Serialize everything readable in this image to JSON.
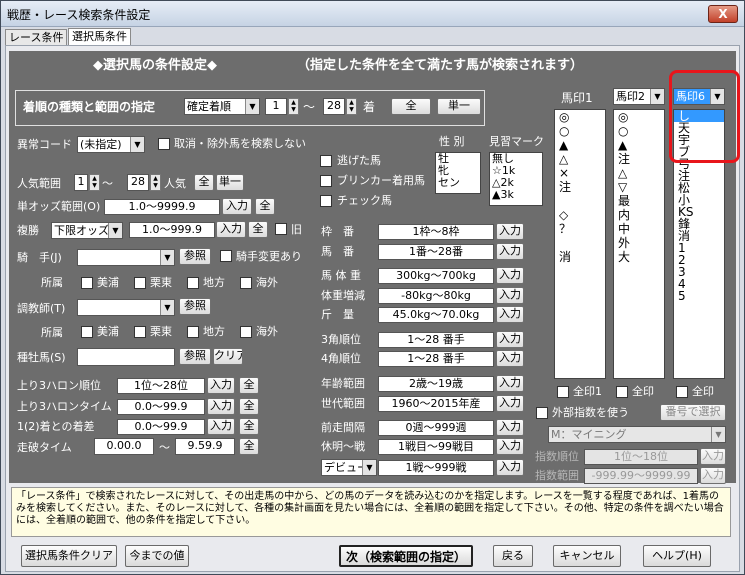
{
  "window": {
    "title": "戦歴・レース検索条件設定",
    "close": "X"
  },
  "tabs": [
    "レース条件",
    "選択馬条件"
  ],
  "header": {
    "title": "◆選択馬の条件設定◆",
    "subtitle": "（指定した条件を全て満たす馬が検索されます）"
  },
  "rank": {
    "label": "着順の種類と範囲の指定",
    "type": "確定着順",
    "from": "1",
    "sep": "～",
    "to": "28",
    "unit": "着",
    "all": "全",
    "single": "単一"
  },
  "ijo": {
    "label": "異常コード",
    "value": "(未指定)",
    "exclude": "取消・除外馬を検索しない"
  },
  "sex": {
    "label": "性 別",
    "items": [
      "牡",
      "牝",
      "セン"
    ]
  },
  "minarai": {
    "label": "見習マーク",
    "items": [
      "無し",
      "☆1k",
      "△2k",
      "▲3k"
    ]
  },
  "flags": [
    "逃げた馬",
    "ブリンカー着用馬",
    "チェック馬"
  ],
  "ninki": {
    "label": "人気範囲",
    "from": "1",
    "sep": "～",
    "to": "28",
    "unit": "人気",
    "all": "全",
    "single": "単一"
  },
  "tanodds": {
    "label": "単オッズ範囲(O)",
    "value": "1.0～9999.9",
    "input": "入力",
    "all": "全"
  },
  "fukusho": {
    "label": "複勝",
    "type": "下限オッズ",
    "value": "1.0～999.9",
    "input": "入力",
    "all": "全",
    "old": "旧"
  },
  "jockey": {
    "label": "騎　手(J)",
    "ref": "参照",
    "change": "騎手変更あり"
  },
  "shozoku": {
    "label": "所属",
    "items": [
      "美浦",
      "栗東",
      "地方",
      "海外"
    ]
  },
  "trainer": {
    "label": "調教師(T)",
    "ref": "参照"
  },
  "sire": {
    "label": "種牡馬(S)",
    "ref": "参照",
    "clear": "クリア"
  },
  "left_rows": [
    {
      "label": "上り3ハロン順位",
      "value": "1位～28位",
      "input": "入力",
      "all": "全"
    },
    {
      "label": "上り3ハロンタイム",
      "value": "0.0～99.9",
      "input": "入力",
      "all": "全"
    },
    {
      "label": "1(2)着との着差",
      "value": "0.0～99.9",
      "input": "入力",
      "all": "全"
    },
    {
      "label": "走破タイム",
      "from": "0.00.0",
      "sep": "～",
      "to": "9.59.9",
      "all": "全"
    }
  ],
  "mid_rows": [
    {
      "label": "枠　番",
      "value": "1枠～8枠",
      "input": "入力"
    },
    {
      "label": "馬　番",
      "value": "1番～28番",
      "input": "入力"
    },
    {
      "label": "馬 体 重",
      "value": "300kg～700kg",
      "input": "入力"
    },
    {
      "label": "体重増減",
      "value": "-80kg～80kg",
      "input": "入力"
    },
    {
      "label": "斤　量",
      "value": "45.0kg～70.0kg",
      "input": "入力"
    },
    {
      "label": "3角順位",
      "value": "1～28 番手",
      "input": "入力"
    },
    {
      "label": "4角順位",
      "value": "1～28 番手",
      "input": "入力"
    },
    {
      "label": "年齢範囲",
      "value": "2歳～19歳",
      "input": "入力"
    },
    {
      "label": "世代範囲",
      "value": "1960～2015年産",
      "input": "入力"
    },
    {
      "label": "前走間隔",
      "value": "0週～999週",
      "input": "入力"
    },
    {
      "label": "休明～戦",
      "value": "1戦目～99戦目",
      "input": "入力"
    },
    {
      "label": "デビュー",
      "value": "1戦～999戦",
      "input": "入力"
    }
  ],
  "marks": {
    "col1": {
      "label": "馬印1",
      "items": [
        "◎",
        "○",
        "▲",
        "△",
        "×",
        "注",
        "",
        "◇",
        "？",
        "",
        "消"
      ],
      "allmark": "全印1"
    },
    "col2": {
      "label": "馬印2",
      "items": [
        "◎",
        "○",
        "▲",
        "注",
        "△",
        "▽",
        "最",
        "内",
        "中",
        "外",
        "大"
      ],
      "allmark": "全印"
    },
    "col3": {
      "label": "馬印6",
      "selected": "し",
      "items": [
        "し",
        "天",
        "宇",
        "ブ",
        "弓",
        "注",
        "松",
        "小",
        "KS",
        "鋒",
        "消",
        "1",
        "2",
        "3",
        "4",
        "5"
      ],
      "allmark": "全印"
    }
  },
  "external": {
    "label": "外部指数を使う",
    "select": "番号で選択",
    "source": "M：マイニング",
    "rank_label": "指数順位",
    "rank_value": "1位～18位",
    "range_label": "指数範囲",
    "range_value": "-999.99～9999.99",
    "input": "入力"
  },
  "note": "「レース条件」で検索されたレースに対して、その出走馬の中から、どの馬のデータを読み込むのかを指定します。レースを一覧する程度であれば、1着馬のみを検索してください。また、そのレースに対して、各種の集計画面を見たい場合には、全着順の範囲を指定して下さい。その他、特定の条件を調べたい場合には、全着順の範囲で、他の条件を指定して下さい。",
  "buttons": {
    "clear": "選択馬条件クリア",
    "prev": "今までの値",
    "next": "次（検索範囲の指定）",
    "back": "戻る",
    "cancel": "キャンセル",
    "help": "ヘルプ(H)"
  }
}
